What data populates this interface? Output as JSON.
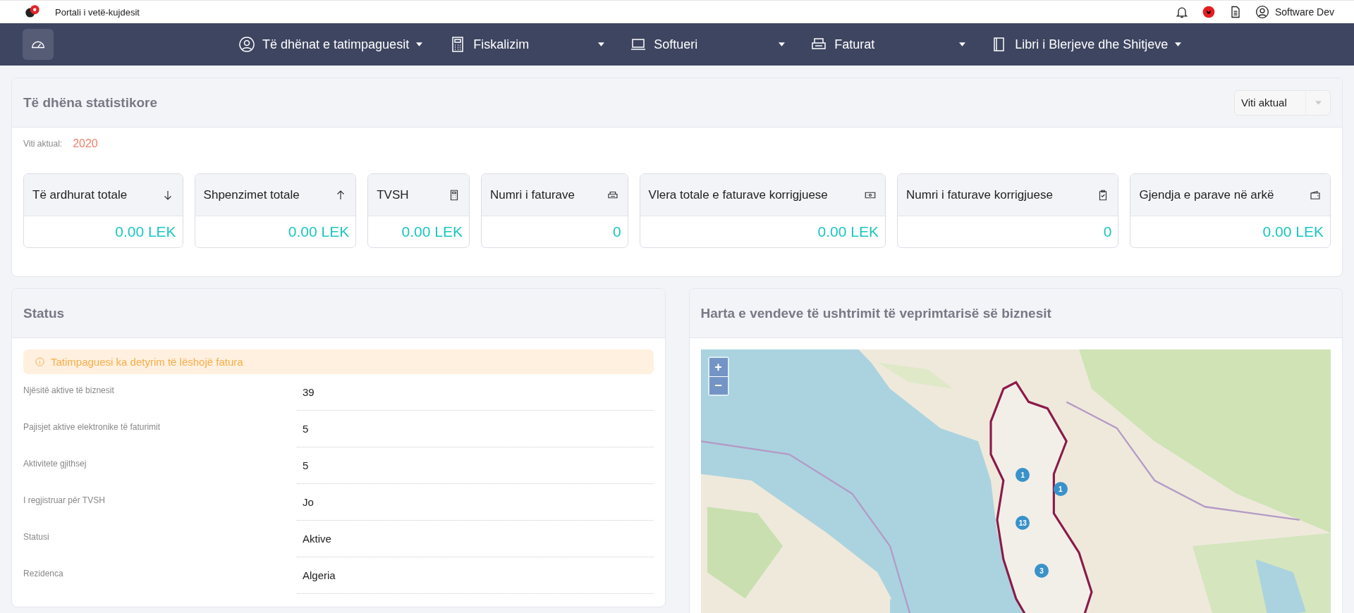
{
  "topbar": {
    "title": "Portali i vetë-kujdesit",
    "user": "Software Dev"
  },
  "nav": [
    {
      "label": "Të dhënat e tatimpaguesit"
    },
    {
      "label": "Fiskalizim"
    },
    {
      "label": "Softueri"
    },
    {
      "label": "Faturat"
    },
    {
      "label": "Libri i Blerjeve dhe Shitjeve"
    }
  ],
  "stats": {
    "title": "Të dhëna statistikore",
    "year_select": "Viti aktual",
    "year_label": "Viti aktual:",
    "year": "2020",
    "cards": [
      {
        "label": "Të ardhurat totale",
        "value": "0.00 LEK"
      },
      {
        "label": "Shpenzimet totale",
        "value": "0.00 LEK"
      },
      {
        "label": "TVSH",
        "value": "0.00 LEK"
      },
      {
        "label": "Numri i faturave",
        "value": "0"
      },
      {
        "label": "Vlera totale e faturave korrigjuese",
        "value": "0.00 LEK"
      },
      {
        "label": "Numri i faturave korrigjuese",
        "value": "0"
      },
      {
        "label": "Gjendja e parave në arkë",
        "value": "0.00 LEK"
      }
    ]
  },
  "status": {
    "title": "Status",
    "alert": "Tatimpaguesi ka detyrim të lëshojë fatura",
    "rows": [
      {
        "label": "Njësitë aktive të biznesit",
        "value": "39"
      },
      {
        "label": "Pajisjet aktive elektronike të faturimit",
        "value": "5"
      },
      {
        "label": "Aktivitete gjithsej",
        "value": "5"
      },
      {
        "label": "I regjistruar për TVSH",
        "value": "Jo"
      },
      {
        "label": "Statusi",
        "value": "Aktive"
      },
      {
        "label": "Rezidenca",
        "value": "Algeria"
      }
    ]
  },
  "map": {
    "title": "Harta e vendeve të ushtrimit të veprimtarisë së biznesit",
    "zoom_in": "+",
    "zoom_out": "−",
    "markers": [
      {
        "count": "1"
      },
      {
        "count": "1"
      },
      {
        "count": "13"
      },
      {
        "count": "3"
      }
    ]
  }
}
